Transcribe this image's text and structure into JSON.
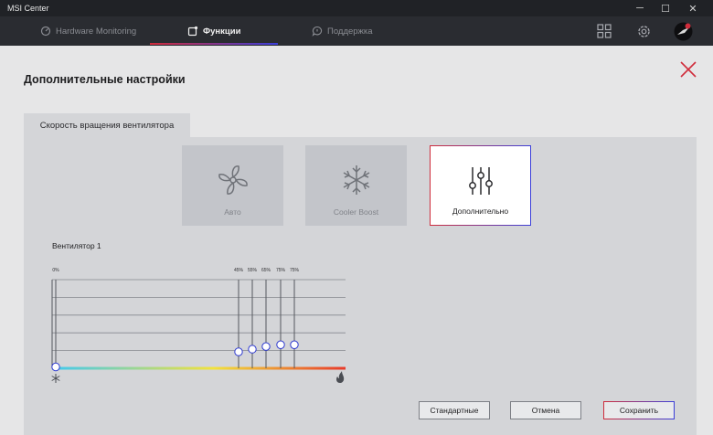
{
  "window": {
    "title": "MSI Center",
    "min_glyph": "─",
    "max_glyph": "☐",
    "close_glyph": "✕"
  },
  "header": {
    "tabs": [
      {
        "label": "Hardware Monitoring",
        "icon": "gauge-icon",
        "active": false
      },
      {
        "label": "Функции",
        "icon": "features-icon",
        "active": true
      },
      {
        "label": "Поддержка",
        "icon": "support-chat-icon",
        "active": false
      }
    ],
    "icons": [
      "grid-apps-icon",
      "gear-icon",
      "avatar"
    ]
  },
  "panel": {
    "title": "Дополнительные настройки",
    "subtab": "Скорость вращения вентилятора",
    "modes": [
      {
        "label": "Авто",
        "icon": "fan-icon",
        "selected": false
      },
      {
        "label": "Cooler Boost",
        "icon": "snowflake-icon",
        "selected": false
      },
      {
        "label": "Дополнительно",
        "icon": "sliders-icon",
        "selected": true
      }
    ],
    "fan_title": "Вентилятор 1",
    "buttons": {
      "default": "Стандартные",
      "cancel": "Отмена",
      "save": "Сохранить"
    }
  },
  "chart_data": {
    "type": "line",
    "points": [
      {
        "label": "0%",
        "level": 0
      },
      {
        "label": "45%",
        "level": 0.17
      },
      {
        "label": "55%",
        "level": 0.2
      },
      {
        "label": "65%",
        "level": 0.23
      },
      {
        "label": "75%",
        "level": 0.25
      },
      {
        "label": "75%",
        "level": 0.25
      }
    ],
    "ylim": [
      0,
      1
    ],
    "grid": true,
    "colors": {
      "gradient_start": "#3fc9f0",
      "gradient_mid": "#f2e23c",
      "gradient_end": "#e83a2a",
      "handle": "#2f3bd1"
    }
  },
  "colors": {
    "accent_red": "#d02c3b",
    "accent_blue": "#3b3fd9"
  }
}
